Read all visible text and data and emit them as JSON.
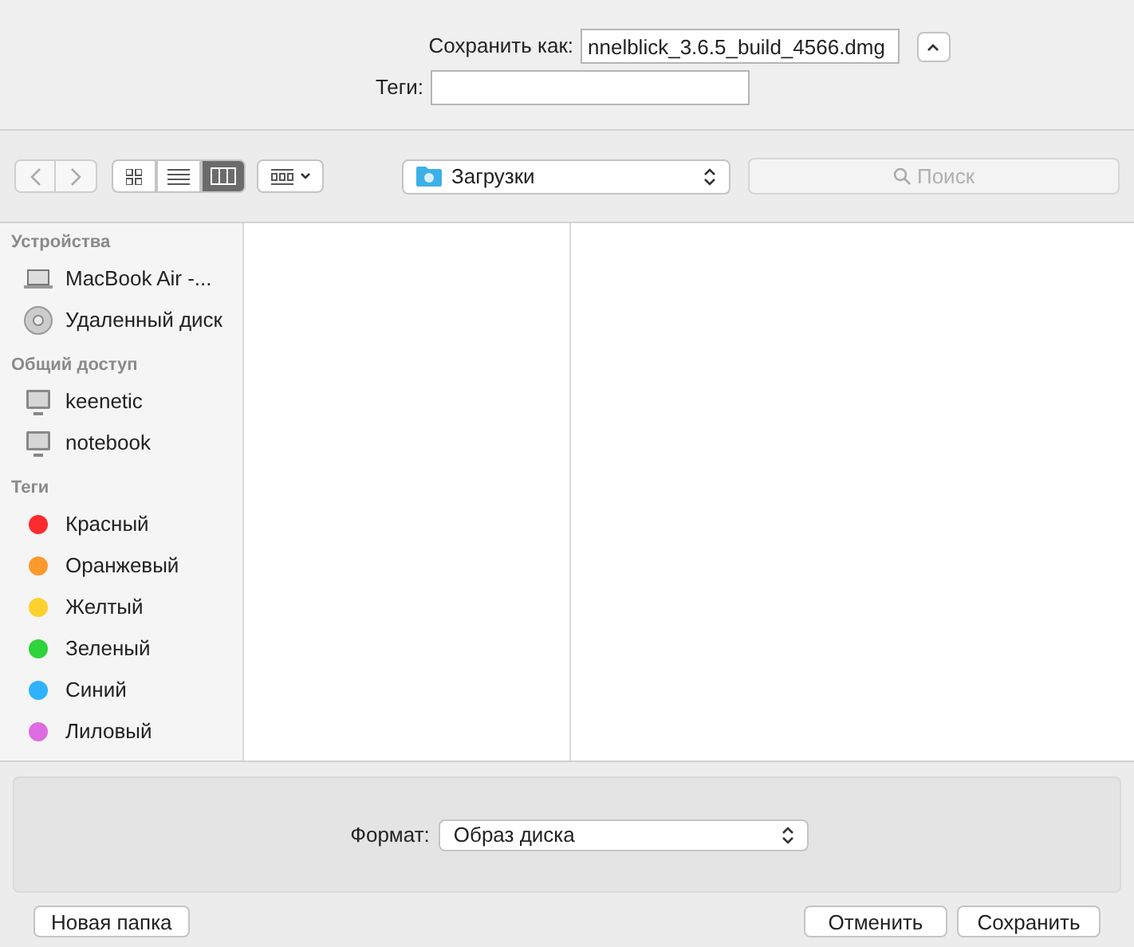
{
  "save_as": {
    "label": "Сохранить как:",
    "value": "nnelblick_3.6.5_build_4566.dmg"
  },
  "tags_field": {
    "label": "Теги:"
  },
  "toolbar": {
    "view_modes": [
      {
        "kind": "icons",
        "selected": false
      },
      {
        "kind": "list",
        "selected": false
      },
      {
        "kind": "columns",
        "selected": true
      }
    ],
    "location": "Загрузки",
    "search": {
      "placeholder": "Поиск"
    }
  },
  "sidebar": {
    "sections": [
      {
        "title": "Устройства",
        "items": [
          {
            "kind": "laptop",
            "label": "MacBook Air -..."
          },
          {
            "kind": "disc",
            "label": "Удаленный диск"
          }
        ]
      },
      {
        "title": "Общий доступ",
        "items": [
          {
            "kind": "computer",
            "label": "keenetic"
          },
          {
            "kind": "computer",
            "label": "notebook"
          }
        ]
      },
      {
        "title": "Теги",
        "items": [
          {
            "kind": "tag",
            "label": "Красный",
            "color": "#fc2b2e"
          },
          {
            "kind": "tag",
            "label": "Оранжевый",
            "color": "#fd9a2e"
          },
          {
            "kind": "tag",
            "label": "Желтый",
            "color": "#fdd12e"
          },
          {
            "kind": "tag",
            "label": "Зеленый",
            "color": "#2fd33a"
          },
          {
            "kind": "tag",
            "label": "Синий",
            "color": "#2fb2fd"
          },
          {
            "kind": "tag",
            "label": "Лиловый",
            "color": "#dd6ce0"
          }
        ]
      }
    ]
  },
  "format": {
    "label": "Формат:",
    "value": "Образ диска"
  },
  "buttons": [
    {
      "kind": "left",
      "label": "Новая папка"
    },
    {
      "kind": "right",
      "label": "Отменить"
    },
    {
      "kind": "right",
      "label": "Сохранить"
    }
  ]
}
